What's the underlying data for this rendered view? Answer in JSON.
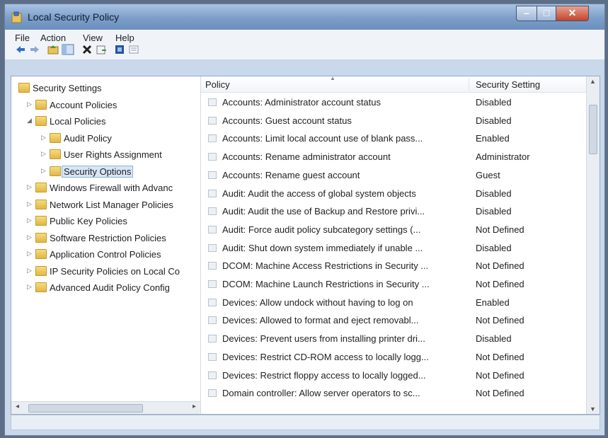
{
  "window": {
    "title": "Local Security Policy"
  },
  "menu": [
    "File",
    "Action",
    "View",
    "Help"
  ],
  "toolbar": [
    "back-icon",
    "forward-icon",
    "up-folder-icon",
    "show-hide-tree-icon",
    "delete-icon",
    "export-icon",
    "help-icon",
    "properties-icon"
  ],
  "tree": {
    "items": [
      {
        "label": "Security Settings",
        "level": 0,
        "expanded": true
      },
      {
        "label": "Account Policies",
        "level": 1,
        "expanded": false
      },
      {
        "label": "Local Policies",
        "level": 1,
        "expanded": true
      },
      {
        "label": "Audit Policy",
        "level": 2,
        "expanded": false
      },
      {
        "label": "User Rights Assignment",
        "level": 2,
        "expanded": false
      },
      {
        "label": "Security Options",
        "level": 2,
        "expanded": false,
        "selected": true
      },
      {
        "label": "Windows Firewall with Advanc",
        "level": 1,
        "expanded": false
      },
      {
        "label": "Network List Manager Policies",
        "level": 1,
        "expanded": false
      },
      {
        "label": "Public Key Policies",
        "level": 1,
        "expanded": false
      },
      {
        "label": "Software Restriction Policies",
        "level": 1,
        "expanded": false
      },
      {
        "label": "Application Control Policies",
        "level": 1,
        "expanded": false
      },
      {
        "label": "IP Security Policies on Local Co",
        "level": 1,
        "expanded": false
      },
      {
        "label": "Advanced Audit Policy Config",
        "level": 1,
        "expanded": false
      }
    ]
  },
  "list": {
    "columns": {
      "policy": "Policy",
      "setting": "Security Setting"
    },
    "rows": [
      {
        "policy": "Accounts: Administrator account status",
        "setting": "Disabled"
      },
      {
        "policy": "Accounts: Guest account status",
        "setting": "Disabled"
      },
      {
        "policy": "Accounts: Limit local account use of blank pass...",
        "setting": "Enabled"
      },
      {
        "policy": "Accounts: Rename administrator account",
        "setting": "Administrator"
      },
      {
        "policy": "Accounts: Rename guest account",
        "setting": "Guest"
      },
      {
        "policy": "Audit: Audit the access of global system objects",
        "setting": "Disabled"
      },
      {
        "policy": "Audit: Audit the use of Backup and Restore privi...",
        "setting": "Disabled"
      },
      {
        "policy": "Audit: Force audit policy subcategory settings (...",
        "setting": "Not Defined"
      },
      {
        "policy": "Audit: Shut down system immediately if unable ...",
        "setting": "Disabled"
      },
      {
        "policy": "DCOM: Machine Access Restrictions in Security ...",
        "setting": "Not Defined"
      },
      {
        "policy": "DCOM: Machine Launch Restrictions in Security ...",
        "setting": "Not Defined"
      },
      {
        "policy": "Devices: Allow undock without having to log on",
        "setting": "Enabled"
      },
      {
        "policy": "Devices: Allowed to format and eject removabl...",
        "setting": "Not Defined"
      },
      {
        "policy": "Devices: Prevent users from installing printer dri...",
        "setting": "Disabled"
      },
      {
        "policy": "Devices: Restrict CD-ROM access to locally logg...",
        "setting": "Not Defined"
      },
      {
        "policy": "Devices: Restrict floppy access to locally logged...",
        "setting": "Not Defined"
      },
      {
        "policy": "Domain controller: Allow server operators to sc...",
        "setting": "Not Defined"
      }
    ]
  }
}
